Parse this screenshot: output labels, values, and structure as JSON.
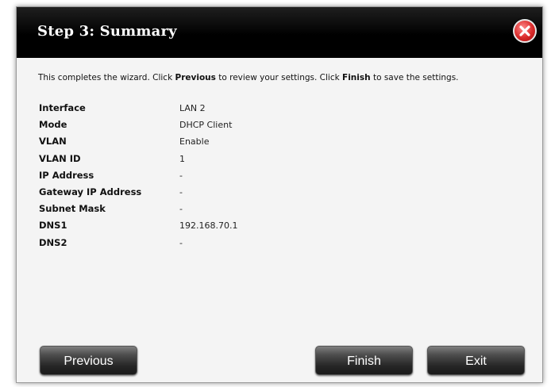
{
  "dialog": {
    "title": "Step 3: Summary"
  },
  "intro": {
    "part1": "This completes the wizard. Click ",
    "previous_word": "Previous",
    "part2": " to review your settings. Click ",
    "finish_word": "Finish",
    "part3": " to save the settings."
  },
  "summary": [
    {
      "label": "Interface",
      "value": "LAN 2"
    },
    {
      "label": "Mode",
      "value": "DHCP Client"
    },
    {
      "label": "VLAN",
      "value": "Enable"
    },
    {
      "label": "VLAN ID",
      "value": "1"
    },
    {
      "label": "IP Address",
      "value": "-"
    },
    {
      "label": "Gateway IP Address",
      "value": "-"
    },
    {
      "label": "Subnet Mask",
      "value": "-"
    },
    {
      "label": "DNS1",
      "value": "192.168.70.1"
    },
    {
      "label": "DNS2",
      "value": "-"
    }
  ],
  "buttons": {
    "previous": "Previous",
    "finish": "Finish",
    "exit": "Exit"
  },
  "icons": {
    "close": "close-icon"
  },
  "colors": {
    "titlebar": "#000000",
    "close_button": "#d92a2a",
    "button": "#2a2a2a"
  }
}
